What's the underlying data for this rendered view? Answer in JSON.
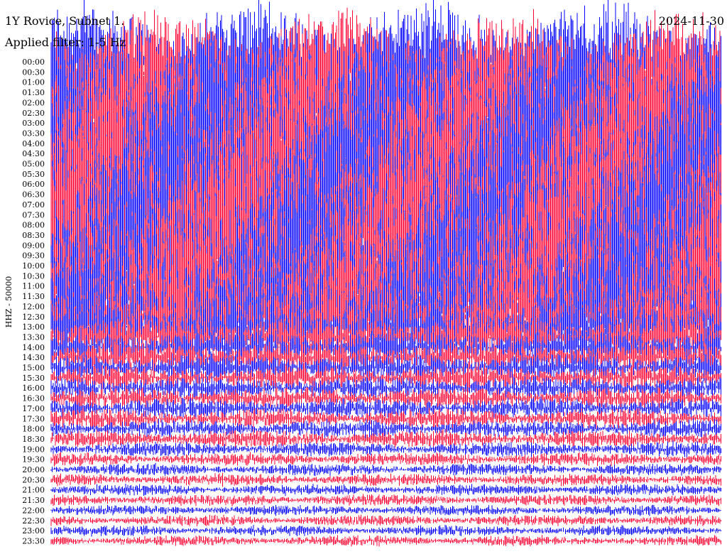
{
  "header": {
    "title_left": "1Y Rovice, Subnet 1.",
    "title_right": "2024-11-30",
    "subtitle": "Applied filter: 1-5 Hz"
  },
  "chart_data": {
    "type": "helicorder",
    "ylabel": "HHZ - 50000",
    "y_tick_labels": [
      "00:00",
      "00:30",
      "01:00",
      "01:30",
      "02:00",
      "02:30",
      "03:00",
      "03:30",
      "04:00",
      "04:30",
      "05:00",
      "05:30",
      "06:00",
      "06:30",
      "07:00",
      "07:30",
      "08:00",
      "08:30",
      "09:00",
      "09:30",
      "10:00",
      "10:30",
      "11:00",
      "11:30",
      "12:00",
      "12:30",
      "13:00",
      "13:30",
      "14:00",
      "14:30",
      "15:00",
      "15:30",
      "16:00",
      "16:30",
      "17:00",
      "17:30",
      "18:00",
      "18:30",
      "19:00",
      "19:30",
      "20:00",
      "20:30",
      "21:00",
      "21:30",
      "22:00",
      "22:30",
      "23:00",
      "23:30"
    ],
    "series_colors": [
      "#0000ff",
      "#ff0033"
    ],
    "trace_amplitude_by_row": [
      9.0,
      9.0,
      9.0,
      9.0,
      9.0,
      9.0,
      9.0,
      9.0,
      9.0,
      9.0,
      9.0,
      9.0,
      9.0,
      9.0,
      9.0,
      9.0,
      9.0,
      9.0,
      9.0,
      9.0,
      8.0,
      7.5,
      7.0,
      6.5,
      6.0,
      5.5,
      4.5,
      3.5,
      3.0,
      2.6,
      2.3,
      2.0,
      1.8,
      1.7,
      1.6,
      1.5,
      1.4,
      1.3,
      1.1,
      1.0,
      0.9,
      0.9,
      0.85,
      0.85,
      0.8,
      0.8,
      0.8,
      0.8
    ],
    "background": "#ffffff",
    "grid": false
  }
}
